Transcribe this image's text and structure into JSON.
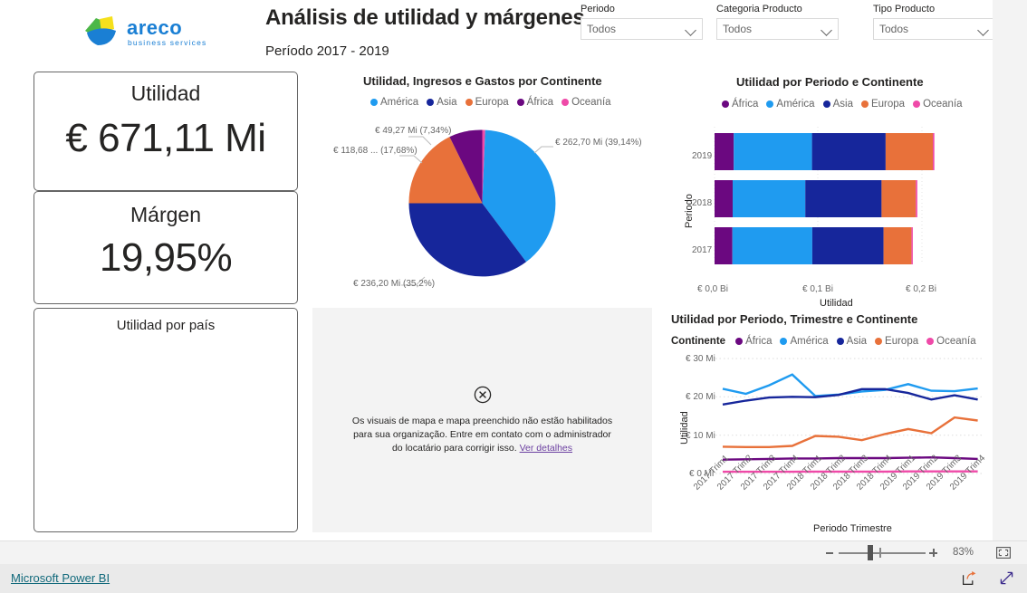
{
  "header": {
    "title": "Análisis de utilidad y márgenes",
    "subtitle": "Período 2017 - 2019",
    "logo_text": "areco",
    "logo_tagline": "business services"
  },
  "slicers": [
    {
      "label": "Periodo",
      "value": "Todos"
    },
    {
      "label": "Categoria Producto",
      "value": "Todos"
    },
    {
      "label": "Tipo Producto",
      "value": "Todos"
    }
  ],
  "cards": [
    {
      "title": "Utilidad",
      "value": "€ 671,11 Mi"
    },
    {
      "title": "Márgen",
      "value": "19,95%"
    },
    {
      "title": "Utilidad por país",
      "value": ""
    }
  ],
  "map_visual": {
    "message_line1": "Os visuais de mapa e mapa preenchido não estão habilitados",
    "message_line2": "para sua organização. Entre em contato com o administrador",
    "message_line3": "do locatário para corrigir isso.",
    "link": "Ver detalhes",
    "icon": "error-circle-x-icon"
  },
  "toolbar": {
    "zoom_pct": "83%",
    "minus_label": "-",
    "plus_label": "+",
    "fit_icon": "fit-to-page-icon"
  },
  "footer": {
    "brand": "Microsoft Power BI",
    "share_icon": "share-icon",
    "fullscreen_icon": "fullscreen-icon"
  },
  "colors": {
    "america": "#1f9bf0",
    "asia": "#16269b",
    "europa": "#e8713a",
    "africa": "#6b0880",
    "oceania": "#ef4aa8",
    "brand_teal": "#11697b",
    "link_purple": "#6b3fa0"
  },
  "chart_data": [
    {
      "id": "pie",
      "type": "pie",
      "title": "Utilidad, Ingresos e Gastos por Continente",
      "legend_position": "top",
      "legend": [
        "América",
        "Asia",
        "Europa",
        "África",
        "Oceanía"
      ],
      "categories": [
        "América",
        "Asia",
        "Europa",
        "África",
        "Oceanía"
      ],
      "values": [
        262.7,
        236.2,
        118.68,
        49.27,
        4.26
      ],
      "percents": [
        39.14,
        35.2,
        17.68,
        7.34,
        0.64
      ],
      "labels": [
        "€ 262,70 Mi (39,14%)",
        "€ 236,20 Mi (35,2%)",
        "€ 118,68 ... (17,68%)",
        "€ 49,27 Mi (7,34%)",
        ""
      ],
      "unit": "Mi"
    },
    {
      "id": "stacked_bar",
      "type": "bar",
      "title": "Utilidad por Periodo e Continente",
      "orientation": "horizontal",
      "stacked": true,
      "legend": [
        "África",
        "América",
        "Asia",
        "Europa",
        "Oceanía"
      ],
      "legend_position": "top",
      "categories": [
        "2019",
        "2018",
        "2017"
      ],
      "xlabel": "Utilidad",
      "ylabel": "Periodo",
      "xticks": [
        "€ 0,0 Bi",
        "€ 0,1 Bi",
        "€ 0,2 Bi"
      ],
      "xlim": [
        0,
        0.23
      ],
      "series": [
        {
          "name": "África",
          "values": [
            0.0185,
            0.0175,
            0.0172
          ]
        },
        {
          "name": "América",
          "values": [
            0.0755,
            0.07,
            0.077
          ]
        },
        {
          "name": "Asia",
          "values": [
            0.071,
            0.0735,
            0.0687
          ]
        },
        {
          "name": "Europa",
          "values": [
            0.0455,
            0.033,
            0.0269
          ]
        },
        {
          "name": "Oceanía",
          "values": [
            0.0015,
            0.0015,
            0.0013
          ]
        }
      ]
    },
    {
      "id": "line",
      "type": "line",
      "title": "Utilidad por Periodo, Trimestre e Continente",
      "legend_caption": "Continente",
      "legend": [
        "África",
        "América",
        "Asia",
        "Europa",
        "Oceanía"
      ],
      "legend_position": "top",
      "xlabel": "Periodo Trimestre",
      "ylabel": "Utilidad",
      "yticks": [
        "€ 0 Mi",
        "€ 10 Mi",
        "€ 20 Mi",
        "€ 30 Mi"
      ],
      "ylim": [
        0,
        30
      ],
      "grid": true,
      "x": [
        "2017 Trim1",
        "2017 Trim2",
        "2017 Trim3",
        "2017 Trim4",
        "2018 Trim1",
        "2018 Trim2",
        "2018 Trim3",
        "2018 Trim4",
        "2019 Trim1",
        "2019 Trim2",
        "2019 Trim3",
        "2019 Trim4"
      ],
      "series": [
        {
          "name": "África",
          "values": [
            3.6,
            3.7,
            3.8,
            3.9,
            3.9,
            4.0,
            4.0,
            4.0,
            4.1,
            4.2,
            4.0,
            3.8
          ]
        },
        {
          "name": "América",
          "values": [
            22.1,
            20.8,
            23.0,
            25.8,
            20.2,
            20.6,
            21.4,
            21.8,
            23.3,
            21.6,
            21.5,
            22.2
          ]
        },
        {
          "name": "Asia",
          "values": [
            18.0,
            19.0,
            19.8,
            20.0,
            19.9,
            20.5,
            22.0,
            22.0,
            21.0,
            19.3,
            20.4,
            19.3
          ]
        },
        {
          "name": "Europa",
          "values": [
            7.0,
            6.9,
            6.9,
            7.2,
            9.8,
            9.6,
            8.7,
            10.3,
            11.6,
            10.5,
            14.6,
            13.8
          ]
        },
        {
          "name": "Oceanía",
          "values": [
            0.45,
            0.45,
            0.45,
            0.45,
            0.5,
            0.5,
            0.5,
            0.5,
            0.55,
            0.55,
            0.55,
            0.55
          ]
        }
      ]
    }
  ]
}
